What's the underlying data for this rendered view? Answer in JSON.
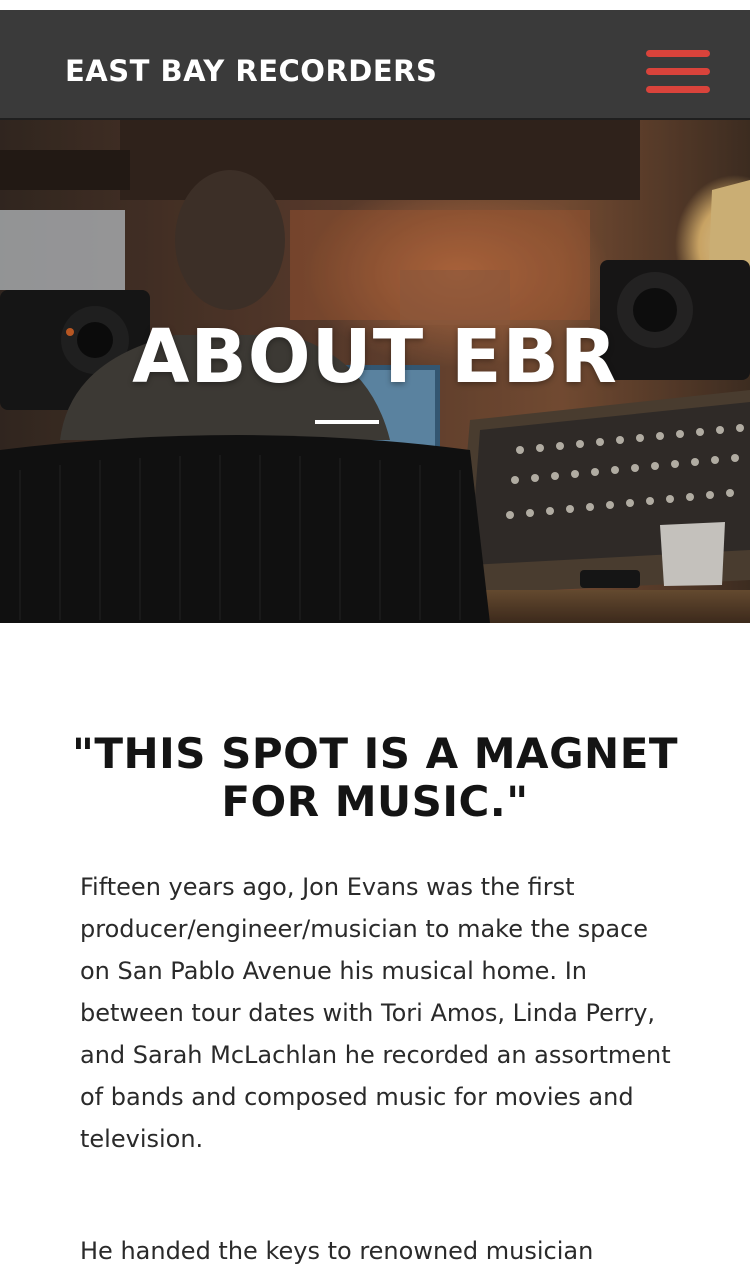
{
  "header": {
    "brand": "EAST BAY RECORDERS",
    "menu_icon": "hamburger-menu-icon",
    "accent_color": "#d9433b",
    "background_color": "#3a3a3a"
  },
  "hero": {
    "title": "ABOUT EBR",
    "image": "recording-studio-photo"
  },
  "content": {
    "quote": "\"THIS SPOT IS A MAGNET FOR MUSIC.\"",
    "paragraphs": [
      "Fifteen years ago, Jon Evans was the first producer/engineer/musician to make the space on San Pablo Avenue his musical home. In between tour dates with Tori Amos, Linda Perry, and Sarah McLachlan he recorded an assortment of bands and composed music for movies and television.",
      "He handed the keys to renowned musician"
    ]
  }
}
